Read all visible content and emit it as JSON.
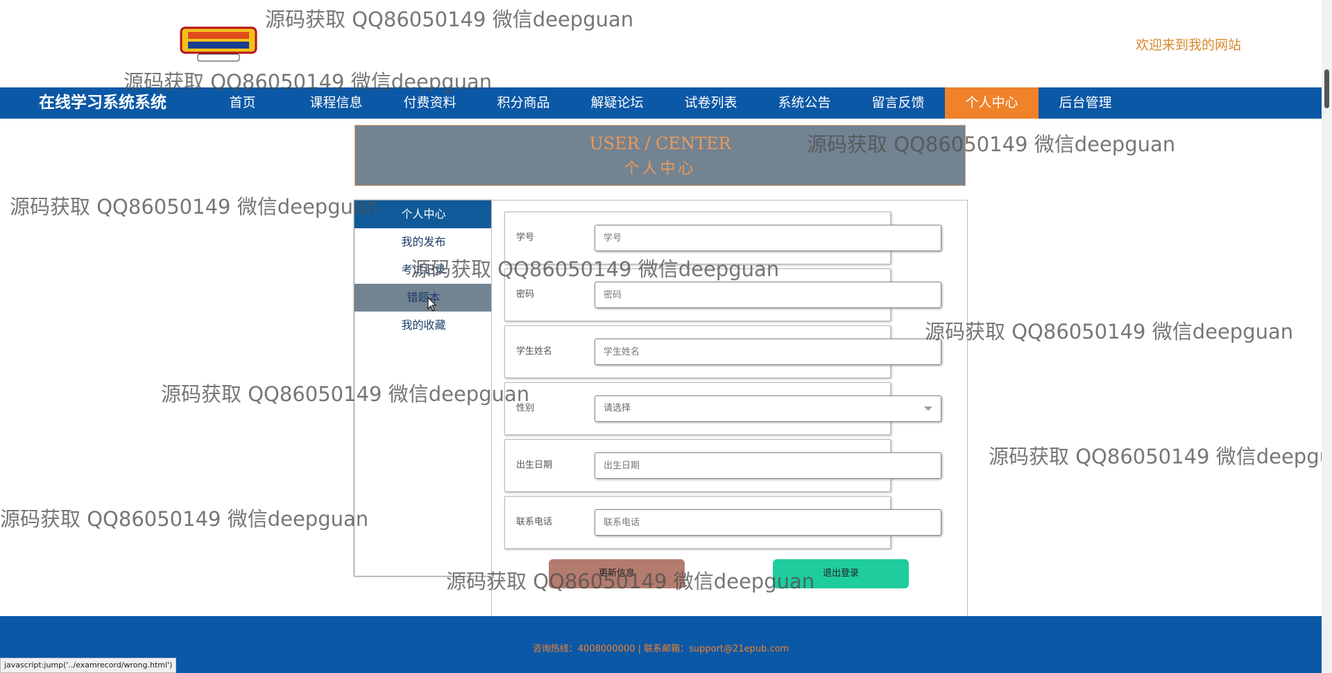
{
  "header": {
    "welcome": "欢迎来到我的网站"
  },
  "nav": {
    "brand": "在线学习系统系统",
    "items": [
      {
        "label": "首页"
      },
      {
        "label": "课程信息"
      },
      {
        "label": "付费资料"
      },
      {
        "label": "积分商品"
      },
      {
        "label": "解疑论坛"
      },
      {
        "label": "试卷列表"
      },
      {
        "label": "系统公告"
      },
      {
        "label": "留言反馈"
      },
      {
        "label": "个人中心",
        "active": true
      },
      {
        "label": "后台管理"
      }
    ]
  },
  "banner": {
    "en": "USER / CENTER",
    "cn": "个人中心"
  },
  "sidebar": {
    "items": [
      {
        "label": "个人中心"
      },
      {
        "label": "我的发布"
      },
      {
        "label": "考试记录"
      },
      {
        "label": "错题本"
      },
      {
        "label": "我的收藏"
      }
    ]
  },
  "form": {
    "fields": [
      {
        "label": "学号",
        "placeholder": "学号"
      },
      {
        "label": "密码",
        "placeholder": "密码"
      },
      {
        "label": "学生姓名",
        "placeholder": "学生姓名"
      },
      {
        "label": "性别",
        "placeholder": "请选择"
      },
      {
        "label": "出生日期",
        "placeholder": "出生日期"
      },
      {
        "label": "联系电话",
        "placeholder": "联系电话"
      }
    ],
    "update_label": "更新信息",
    "logout_label": "退出登录"
  },
  "footer": {
    "text": "咨询热线：4008000000 | 联系邮箱：support@21epub.com"
  },
  "status_bar": {
    "text": "javascript:jump('../examrecord/wrong.html')"
  },
  "watermark": {
    "text": "源码获取 QQ86050149 微信deepguan"
  },
  "colors": {
    "nav_bg": "#0b58a6",
    "accent": "#f0822a",
    "logout": "#1ecc9e",
    "update": "#b37c6f"
  }
}
